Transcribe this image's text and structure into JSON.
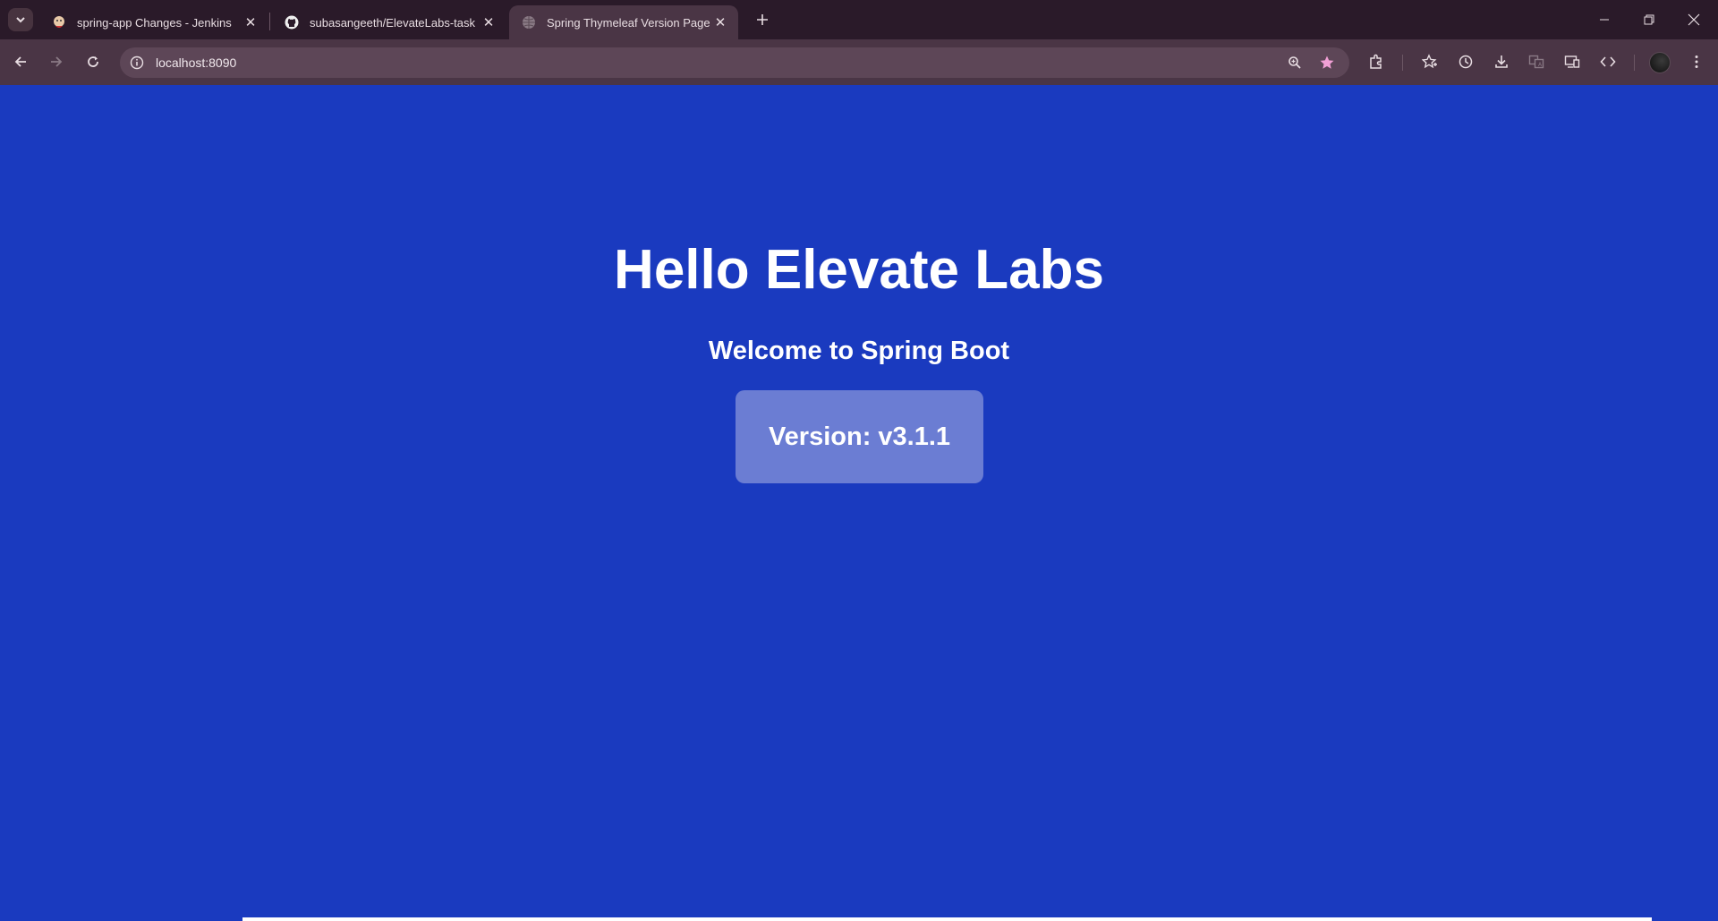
{
  "browser": {
    "tabs": [
      {
        "title": "spring-app Changes - Jenkins",
        "icon": "jenkins-icon",
        "active": false
      },
      {
        "title": "subasangeeth/ElevateLabs-task",
        "icon": "github-icon",
        "active": false
      },
      {
        "title": "Spring Thymeleaf Version Page",
        "icon": "globe-icon",
        "active": true
      }
    ],
    "url": "localhost:8090",
    "accent_star_color": "#f2a0d6"
  },
  "page": {
    "heading": "Hello Elevate Labs",
    "subheading": "Welcome to Spring Boot",
    "version_label": "Version: v3.1.1",
    "background_color": "#1a3abf",
    "version_box_color": "#6b7dd3"
  }
}
